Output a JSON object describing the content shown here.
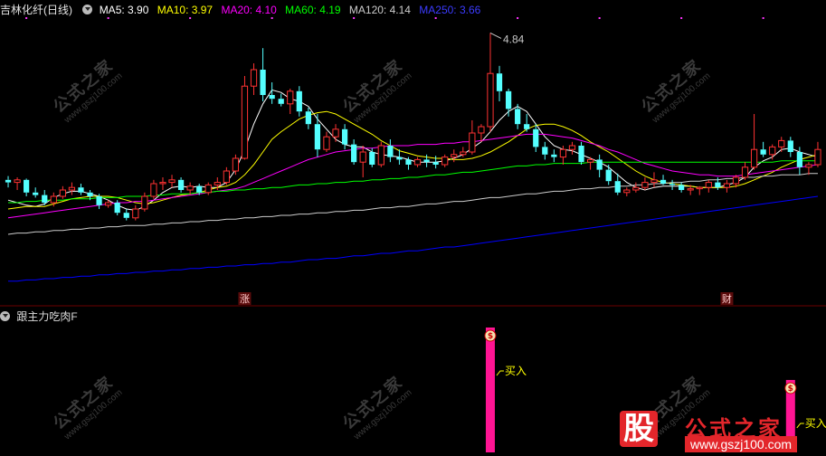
{
  "header": {
    "stock_title": "吉林化纤(日线)",
    "ma_labels": [
      {
        "text": "MA5: 3.90",
        "color": "#ffffff"
      },
      {
        "text": "MA10: 3.97",
        "color": "#ffff00"
      },
      {
        "text": "MA20: 4.10",
        "color": "#ff00ff"
      },
      {
        "text": "MA60: 4.19",
        "color": "#00ff00"
      },
      {
        "text": "MA120: 4.14",
        "color": "#cccccc"
      },
      {
        "text": "MA250: 3.66",
        "color": "#0000ff"
      }
    ]
  },
  "sub_panel": {
    "indicator_name": "跟主力吃肉F",
    "buy_label": "买入"
  },
  "watermark": {
    "text": "公式之家",
    "url": "www.gszj100.com"
  },
  "logo": {
    "big": "股",
    "name": "公式之家",
    "url": "www.gszj100.com"
  },
  "colors": {
    "up": "#ff3232",
    "down": "#54ffff",
    "signal": "#ff1493",
    "max_label": "#c8c8c8"
  },
  "chart_data": {
    "type": "candlestick",
    "price_range": [
      2.8,
      4.9
    ],
    "max_marker": {
      "value": "4.84",
      "index": 53
    },
    "event_marks": [
      {
        "index": 26,
        "text": "涨"
      },
      {
        "index": 79,
        "text": "财"
      }
    ],
    "candles": [
      [
        3.68,
        3.71,
        3.62,
        3.66
      ],
      [
        3.66,
        3.7,
        3.6,
        3.68
      ],
      [
        3.68,
        3.69,
        3.55,
        3.58
      ],
      [
        3.58,
        3.62,
        3.54,
        3.56
      ],
      [
        3.56,
        3.6,
        3.48,
        3.5
      ],
      [
        3.5,
        3.58,
        3.47,
        3.55
      ],
      [
        3.55,
        3.63,
        3.53,
        3.6
      ],
      [
        3.6,
        3.66,
        3.56,
        3.62
      ],
      [
        3.62,
        3.65,
        3.56,
        3.58
      ],
      [
        3.58,
        3.6,
        3.52,
        3.55
      ],
      [
        3.55,
        3.57,
        3.45,
        3.48
      ],
      [
        3.48,
        3.52,
        3.46,
        3.5
      ],
      [
        3.5,
        3.52,
        3.4,
        3.42
      ],
      [
        3.42,
        3.45,
        3.36,
        3.38
      ],
      [
        3.38,
        3.48,
        3.36,
        3.45
      ],
      [
        3.45,
        3.58,
        3.43,
        3.55
      ],
      [
        3.55,
        3.68,
        3.53,
        3.65
      ],
      [
        3.65,
        3.7,
        3.6,
        3.66
      ],
      [
        3.66,
        3.72,
        3.62,
        3.68
      ],
      [
        3.68,
        3.7,
        3.58,
        3.6
      ],
      [
        3.6,
        3.66,
        3.56,
        3.63
      ],
      [
        3.63,
        3.65,
        3.56,
        3.58
      ],
      [
        3.58,
        3.66,
        3.56,
        3.64
      ],
      [
        3.64,
        3.7,
        3.6,
        3.66
      ],
      [
        3.66,
        3.78,
        3.64,
        3.75
      ],
      [
        3.75,
        3.88,
        3.72,
        3.85
      ],
      [
        3.85,
        4.5,
        3.84,
        4.42
      ],
      [
        4.42,
        4.6,
        4.35,
        4.55
      ],
      [
        4.55,
        4.72,
        4.3,
        4.35
      ],
      [
        4.35,
        4.45,
        4.28,
        4.32
      ],
      [
        4.32,
        4.36,
        4.26,
        4.28
      ],
      [
        4.28,
        4.4,
        4.2,
        4.38
      ],
      [
        4.38,
        4.42,
        4.18,
        4.22
      ],
      [
        4.22,
        4.25,
        4.08,
        4.12
      ],
      [
        4.12,
        4.2,
        3.86,
        3.92
      ],
      [
        3.92,
        4.06,
        3.9,
        4.02
      ],
      [
        4.02,
        4.12,
        3.98,
        4.08
      ],
      [
        4.08,
        4.12,
        3.92,
        3.96
      ],
      [
        3.96,
        4.0,
        3.8,
        3.82
      ],
      [
        3.82,
        3.95,
        3.7,
        3.9
      ],
      [
        3.9,
        3.93,
        3.78,
        3.8
      ],
      [
        3.8,
        3.98,
        3.78,
        3.95
      ],
      [
        3.95,
        4.0,
        3.82,
        3.86
      ],
      [
        3.86,
        3.92,
        3.8,
        3.84
      ],
      [
        3.84,
        3.86,
        3.76,
        3.8
      ],
      [
        3.8,
        3.86,
        3.78,
        3.84
      ],
      [
        3.84,
        3.88,
        3.78,
        3.82
      ],
      [
        3.82,
        3.87,
        3.77,
        3.8
      ],
      [
        3.8,
        3.88,
        3.78,
        3.86
      ],
      [
        3.86,
        3.92,
        3.82,
        3.88
      ],
      [
        3.88,
        3.94,
        3.86,
        3.9
      ],
      [
        3.9,
        4.15,
        3.88,
        4.05
      ],
      [
        4.05,
        4.12,
        3.98,
        4.1
      ],
      [
        4.1,
        4.84,
        4.06,
        4.52
      ],
      [
        4.52,
        4.58,
        4.3,
        4.38
      ],
      [
        4.38,
        4.4,
        4.18,
        4.24
      ],
      [
        4.24,
        4.28,
        4.08,
        4.12
      ],
      [
        4.12,
        4.2,
        4.06,
        4.08
      ],
      [
        4.08,
        4.12,
        3.9,
        3.94
      ],
      [
        3.94,
        3.98,
        3.84,
        3.88
      ],
      [
        3.88,
        3.92,
        3.82,
        3.86
      ],
      [
        3.86,
        3.95,
        3.8,
        3.92
      ],
      [
        3.92,
        3.98,
        3.88,
        3.95
      ],
      [
        3.95,
        3.98,
        3.8,
        3.82
      ],
      [
        3.82,
        3.86,
        3.76,
        3.84
      ],
      [
        3.84,
        3.88,
        3.7,
        3.76
      ],
      [
        3.76,
        3.8,
        3.64,
        3.67
      ],
      [
        3.67,
        3.73,
        3.56,
        3.58
      ],
      [
        3.58,
        3.62,
        3.55,
        3.6
      ],
      [
        3.6,
        3.66,
        3.58,
        3.62
      ],
      [
        3.62,
        3.7,
        3.6,
        3.66
      ],
      [
        3.66,
        3.74,
        3.62,
        3.68
      ],
      [
        3.68,
        3.72,
        3.64,
        3.65
      ],
      [
        3.65,
        3.68,
        3.6,
        3.64
      ],
      [
        3.64,
        3.66,
        3.58,
        3.6
      ],
      [
        3.6,
        3.64,
        3.56,
        3.61
      ],
      [
        3.61,
        3.63,
        3.56,
        3.62
      ],
      [
        3.62,
        3.68,
        3.58,
        3.66
      ],
      [
        3.66,
        3.7,
        3.6,
        3.62
      ],
      [
        3.62,
        3.68,
        3.58,
        3.65
      ],
      [
        3.65,
        3.72,
        3.62,
        3.7
      ],
      [
        3.7,
        3.82,
        3.68,
        3.78
      ],
      [
        3.78,
        4.2,
        3.76,
        3.92
      ],
      [
        3.92,
        3.98,
        3.86,
        3.88
      ],
      [
        3.88,
        3.96,
        3.84,
        3.94
      ],
      [
        3.94,
        4.02,
        3.9,
        3.99
      ],
      [
        3.99,
        4.02,
        3.86,
        3.9
      ],
      [
        3.9,
        3.94,
        3.72,
        3.78
      ],
      [
        3.78,
        3.82,
        3.72,
        3.8
      ],
      [
        3.8,
        3.98,
        3.78,
        3.92
      ]
    ],
    "ma_lines": [
      {
        "name": "MA5",
        "color": "#ffffff",
        "values": [
          3.52,
          3.5,
          3.48,
          3.47,
          3.49,
          3.54,
          3.57,
          3.59,
          3.59,
          3.57,
          3.55,
          3.52,
          3.48,
          3.45,
          3.44,
          3.47,
          3.52,
          3.58,
          3.62,
          3.63,
          3.62,
          3.63,
          3.62,
          3.62,
          3.66,
          3.76,
          3.92,
          4.12,
          4.28,
          4.39,
          4.37,
          4.32,
          4.3,
          4.26,
          4.16,
          4.08,
          4.0,
          3.96,
          3.94,
          3.94,
          3.9,
          3.88,
          3.87,
          3.86,
          3.84,
          3.82,
          3.82,
          3.82,
          3.83,
          3.85,
          3.88,
          3.93,
          3.98,
          4.06,
          4.15,
          4.22,
          4.26,
          4.22,
          4.12,
          4.02,
          3.95,
          3.92,
          3.91,
          3.88,
          3.85,
          3.82,
          3.78,
          3.72,
          3.66,
          3.62,
          3.6,
          3.62,
          3.63,
          3.63,
          3.63,
          3.63,
          3.62,
          3.62,
          3.62,
          3.64,
          3.66,
          3.7,
          3.78,
          3.83,
          3.86,
          3.92,
          3.93,
          3.9,
          3.88,
          3.86
        ]
      },
      {
        "name": "MA10",
        "color": "#ffff00",
        "values": [
          3.45,
          3.46,
          3.47,
          3.47,
          3.47,
          3.49,
          3.51,
          3.53,
          3.54,
          3.55,
          3.55,
          3.55,
          3.54,
          3.52,
          3.5,
          3.49,
          3.5,
          3.52,
          3.54,
          3.56,
          3.57,
          3.58,
          3.6,
          3.62,
          3.63,
          3.66,
          3.72,
          3.8,
          3.9,
          4.0,
          4.06,
          4.11,
          4.16,
          4.19,
          4.21,
          4.22,
          4.2,
          4.16,
          4.12,
          4.08,
          4.04,
          3.99,
          3.95,
          3.91,
          3.89,
          3.87,
          3.86,
          3.85,
          3.85,
          3.84,
          3.84,
          3.85,
          3.87,
          3.9,
          3.94,
          3.98,
          4.03,
          4.08,
          4.11,
          4.12,
          4.12,
          4.1,
          4.07,
          4.03,
          3.98,
          3.94,
          3.9,
          3.85,
          3.8,
          3.75,
          3.71,
          3.68,
          3.66,
          3.65,
          3.64,
          3.63,
          3.62,
          3.62,
          3.62,
          3.62,
          3.63,
          3.65,
          3.68,
          3.71,
          3.74,
          3.78,
          3.81,
          3.84,
          3.86,
          3.88
        ]
      },
      {
        "name": "MA20",
        "color": "#ff00ff",
        "values": [
          3.38,
          3.39,
          3.4,
          3.41,
          3.42,
          3.43,
          3.44,
          3.45,
          3.46,
          3.47,
          3.48,
          3.49,
          3.5,
          3.5,
          3.51,
          3.51,
          3.52,
          3.53,
          3.54,
          3.55,
          3.56,
          3.57,
          3.58,
          3.59,
          3.6,
          3.61,
          3.63,
          3.66,
          3.69,
          3.72,
          3.75,
          3.78,
          3.81,
          3.84,
          3.86,
          3.88,
          3.9,
          3.91,
          3.92,
          3.93,
          3.93,
          3.94,
          3.95,
          3.95,
          3.95,
          3.96,
          3.96,
          3.96,
          3.97,
          3.97,
          3.98,
          3.98,
          3.99,
          4.0,
          4.01,
          4.02,
          4.03,
          4.04,
          4.04,
          4.04,
          4.03,
          4.02,
          4.01,
          3.99,
          3.97,
          3.95,
          3.92,
          3.9,
          3.87,
          3.84,
          3.81,
          3.79,
          3.77,
          3.75,
          3.74,
          3.73,
          3.72,
          3.72,
          3.71,
          3.71,
          3.71,
          3.72,
          3.73,
          3.74,
          3.75,
          3.76,
          3.77,
          3.78,
          3.79,
          3.8
        ]
      },
      {
        "name": "MA60",
        "color": "#00ff00",
        "values": [
          3.5,
          3.5,
          3.51,
          3.51,
          3.52,
          3.52,
          3.52,
          3.53,
          3.53,
          3.53,
          3.54,
          3.54,
          3.54,
          3.55,
          3.55,
          3.55,
          3.56,
          3.56,
          3.57,
          3.57,
          3.57,
          3.58,
          3.58,
          3.59,
          3.59,
          3.6,
          3.6,
          3.61,
          3.61,
          3.62,
          3.62,
          3.63,
          3.64,
          3.64,
          3.65,
          3.65,
          3.66,
          3.66,
          3.67,
          3.67,
          3.68,
          3.68,
          3.69,
          3.69,
          3.7,
          3.7,
          3.71,
          3.72,
          3.72,
          3.73,
          3.74,
          3.74,
          3.75,
          3.76,
          3.77,
          3.78,
          3.79,
          3.79,
          3.8,
          3.8,
          3.81,
          3.81,
          3.81,
          3.81,
          3.82,
          3.82,
          3.82,
          3.82,
          3.82,
          3.82,
          3.82,
          3.82,
          3.82,
          3.82,
          3.82,
          3.82,
          3.82,
          3.82,
          3.82,
          3.82,
          3.82,
          3.82,
          3.82,
          3.82,
          3.82,
          3.83,
          3.83,
          3.83,
          3.83,
          3.83
        ]
      },
      {
        "name": "MA120",
        "color": "#cccccc",
        "values": [
          3.25,
          3.26,
          3.26,
          3.27,
          3.27,
          3.28,
          3.28,
          3.29,
          3.29,
          3.3,
          3.3,
          3.31,
          3.31,
          3.32,
          3.32,
          3.32,
          3.33,
          3.33,
          3.34,
          3.34,
          3.35,
          3.35,
          3.36,
          3.36,
          3.37,
          3.37,
          3.38,
          3.38,
          3.39,
          3.39,
          3.4,
          3.4,
          3.41,
          3.41,
          3.42,
          3.42,
          3.43,
          3.43,
          3.44,
          3.44,
          3.45,
          3.46,
          3.46,
          3.47,
          3.47,
          3.48,
          3.49,
          3.49,
          3.5,
          3.51,
          3.51,
          3.52,
          3.53,
          3.54,
          3.54,
          3.55,
          3.56,
          3.57,
          3.57,
          3.58,
          3.59,
          3.59,
          3.6,
          3.61,
          3.61,
          3.62,
          3.62,
          3.63,
          3.63,
          3.64,
          3.64,
          3.65,
          3.65,
          3.66,
          3.66,
          3.67,
          3.67,
          3.68,
          3.68,
          3.69,
          3.69,
          3.7,
          3.7,
          3.71,
          3.71,
          3.72,
          3.72,
          3.72,
          3.73,
          3.73
        ]
      },
      {
        "name": "MA250",
        "color": "#0000ff",
        "values": [
          2.88,
          2.88,
          2.89,
          2.89,
          2.9,
          2.9,
          2.91,
          2.91,
          2.92,
          2.92,
          2.93,
          2.93,
          2.94,
          2.94,
          2.95,
          2.95,
          2.96,
          2.96,
          2.97,
          2.97,
          2.98,
          2.98,
          2.99,
          2.99,
          3.0,
          3.0,
          3.01,
          3.01,
          3.02,
          3.02,
          3.03,
          3.03,
          3.04,
          3.05,
          3.05,
          3.06,
          3.06,
          3.07,
          3.08,
          3.08,
          3.09,
          3.1,
          3.1,
          3.11,
          3.12,
          3.12,
          3.13,
          3.14,
          3.15,
          3.15,
          3.16,
          3.17,
          3.18,
          3.19,
          3.2,
          3.21,
          3.22,
          3.23,
          3.24,
          3.25,
          3.26,
          3.27,
          3.28,
          3.29,
          3.3,
          3.31,
          3.32,
          3.33,
          3.34,
          3.35,
          3.36,
          3.37,
          3.38,
          3.39,
          3.4,
          3.41,
          3.42,
          3.43,
          3.44,
          3.45,
          3.46,
          3.47,
          3.48,
          3.49,
          3.5,
          3.51,
          3.52,
          3.53,
          3.54,
          3.55
        ]
      }
    ],
    "signals": [
      {
        "index": 53,
        "text": "买入",
        "level": 1.0
      },
      {
        "index": 86,
        "text": "买入",
        "level": 0.58
      }
    ]
  }
}
